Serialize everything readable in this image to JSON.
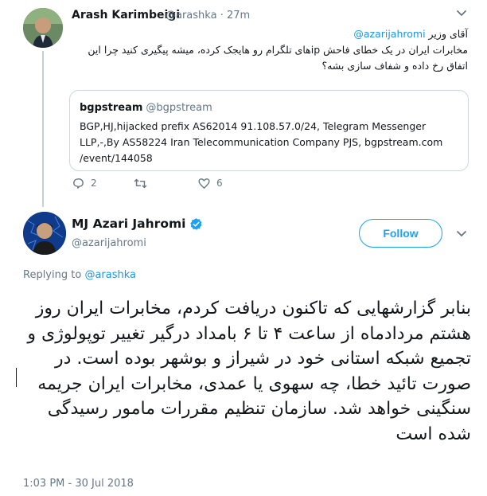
{
  "reply_tweet": {
    "author_name": "Arash Karimbeigi",
    "handle_time": "@arashka · 27m",
    "text_prefix": "آقای وزیر ",
    "mention": "@azarijahromi",
    "text_rest": "مخابرات ایران در یک خطای فاحش ipهای تلگرام رو هایجک کرده، میشه پیگیری کنید چرا این اتفاق رخ داده و شفاف سازی بشه؟",
    "quoted": {
      "name": "bgpstream",
      "handle": "@bgpstream",
      "text": "BGP,HJ,hijacked prefix AS62014 91.108.57.0/24, Telegram Messenger LLP,-,By AS58224 Iran Telecommunication Company PJS, bgpstream.com /event/144058"
    },
    "actions": {
      "reply_count": "2",
      "retweet_count": "",
      "like_count": "6"
    }
  },
  "main_tweet": {
    "author_name": "MJ Azari Jahromi",
    "handle": "@azarijahromi",
    "follow_label": "Follow",
    "replying_prefix": "Replying to ",
    "replying_to": "@arashka",
    "text": "بنابر گزارشهایی که تاکنون دریافت کردم، مخابرات ایران روز هشتم مردادماه از ساعت ۴ تا ۶ بامداد درگیر تغییر توپولوژی و تجمیع شبکه استانی خود در شیراز و بوشهر بوده است. در صورت تائید خطا، چه سهوی یا عمدی، مخابرات ایران جریمه سنگینی خواهد شد. سازمان تنظیم مقررات مامور رسیدگی شده است",
    "timestamp": "1:03 PM - 30 Jul 2018"
  },
  "colors": {
    "link": "#1b95e0",
    "brand": "#1da1f2",
    "muted": "#657786",
    "text": "#14171a",
    "border": "#ccd6dd"
  },
  "icons": [
    "chevron-down-icon",
    "reply-icon",
    "retweet-icon",
    "like-icon",
    "verified-badge-icon"
  ]
}
